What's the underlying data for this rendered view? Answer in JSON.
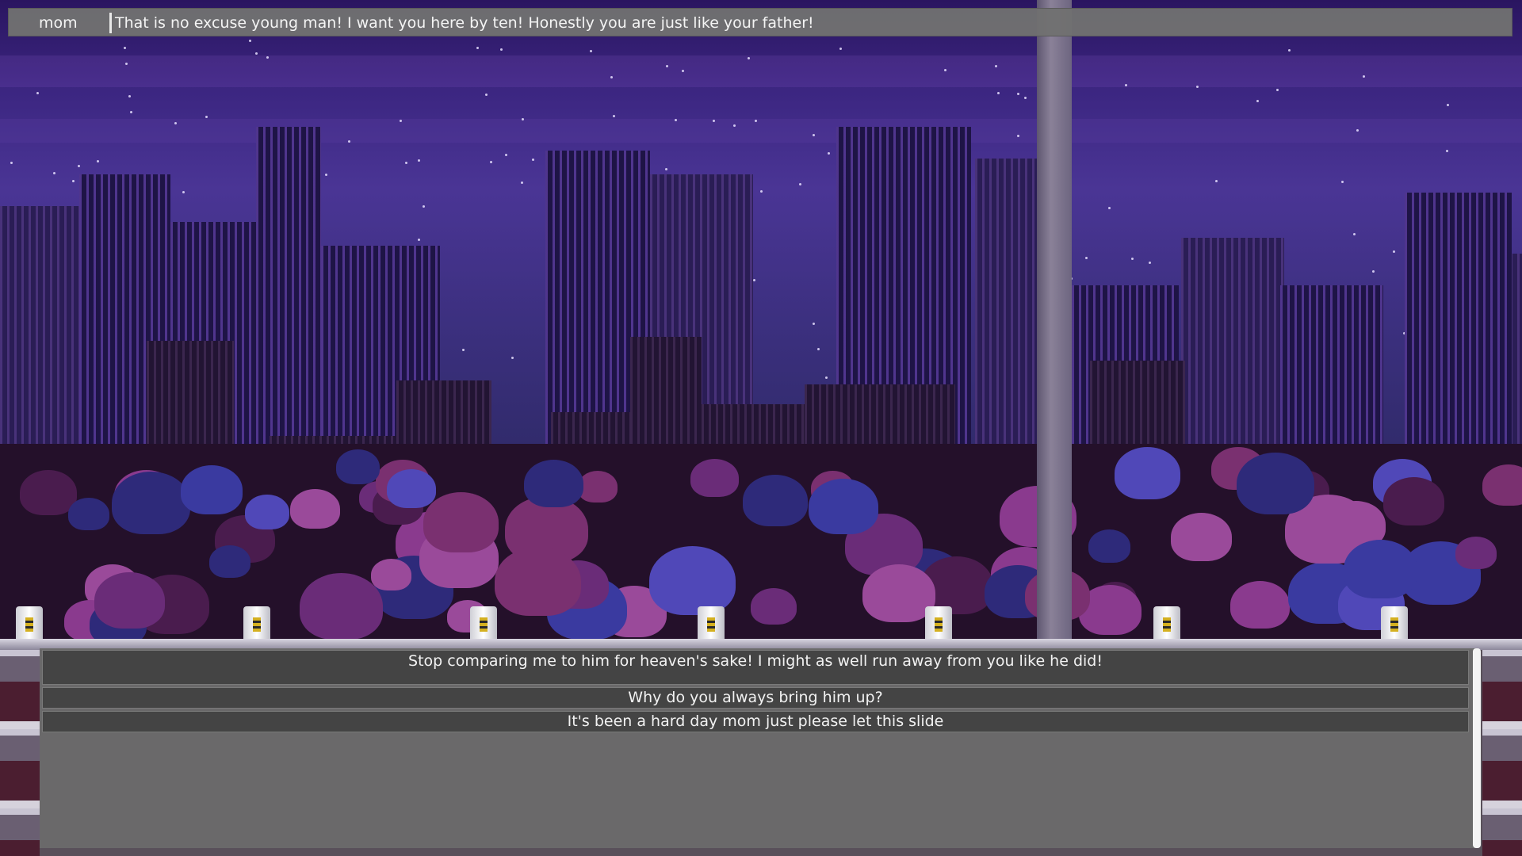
{
  "dialogue": {
    "speaker": "mom",
    "line": "That is no excuse young man! I want you here by ten! Honestly you are just like your father!"
  },
  "choices": [
    {
      "label": "Stop comparing me to him for heaven's sake! I might as well run away from you like he did!"
    },
    {
      "label": "Why do you always bring him up?"
    },
    {
      "label": "It's been a hard day mom just please let this slide"
    }
  ],
  "scene": {
    "setting": "night city skyline seen through window",
    "colors": {
      "sky": "#3b2580",
      "buildings": "#1e1446",
      "panel": "#6a6a6a",
      "choice": "#444444"
    }
  }
}
